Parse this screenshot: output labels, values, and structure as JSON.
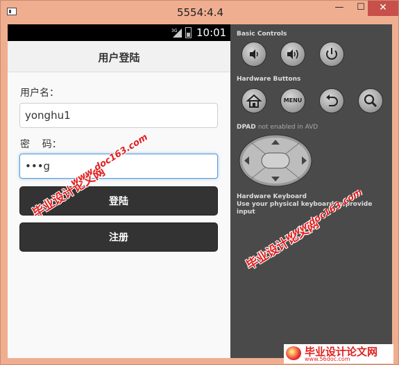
{
  "window": {
    "title": "5554:4.4",
    "minimize_glyph": "—",
    "maximize_glyph": "☐",
    "close_glyph": "✕"
  },
  "statusbar": {
    "time": "10:01",
    "signal_label": "3G"
  },
  "screen": {
    "title": "用户登陆",
    "username_label": "用户名：",
    "username_value": "yonghu1",
    "password_label": "密    码：",
    "password_value": "•••g",
    "login_button": "登陆",
    "register_button": "注册"
  },
  "panel": {
    "basic_controls": "Basic Controls",
    "hardware_buttons": "Hardware Buttons",
    "menu_label": "MENU",
    "dpad_title": "DPAD",
    "dpad_note": "not enabled in AVD",
    "keyboard_title": "Hardware Keyboard",
    "keyboard_note": "Use your physical keyboard to provide input"
  },
  "watermarks": {
    "cn": "毕业设计论文网",
    "url": "www.doc163.com",
    "footer_url": "www.56doc.com"
  },
  "colors": {
    "window_frame": "#f0ae90",
    "close_button": "#c7504b",
    "button_dark": "#333333",
    "panel_bg": "#4a4a4a",
    "focus_blue": "#5a9ad6",
    "watermark_red": "#e02020"
  }
}
